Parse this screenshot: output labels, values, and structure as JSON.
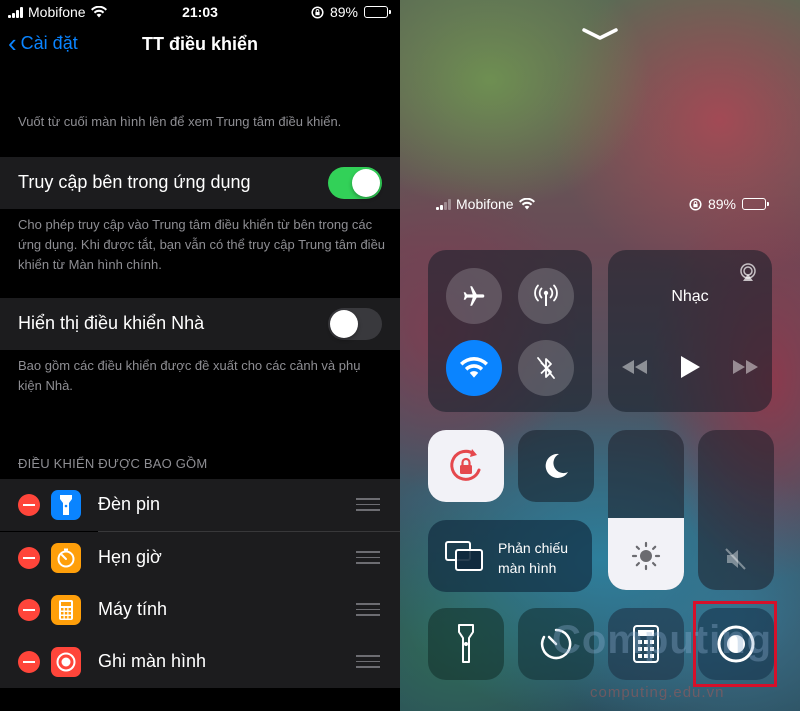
{
  "status_left": {
    "carrier": "Mobifone",
    "time": "21:03",
    "battery": "89%"
  },
  "settings": {
    "back_label": "Cài đặt",
    "title": "TT điều khiển",
    "intro": "Vuốt từ cuối màn hình lên để xem Trung tâm điều khiển.",
    "access_label": "Truy cập bên trong ứng dụng",
    "access_on": true,
    "access_desc": "Cho phép truy cập vào Trung tâm điều khiển từ bên trong các ứng dụng. Khi được tắt, bạn vẫn có thể truy cập Trung tâm điều khiển từ Màn hình chính.",
    "home_label": "Hiển thị điều khiển Nhà",
    "home_on": false,
    "home_desc": "Bao gồm các điều khiển được đề xuất cho các cảnh và phụ kiện Nhà.",
    "section_header": "ĐIỀU KHIỂN ĐƯỢC BAO GỒM",
    "controls": [
      {
        "label": "Đèn pin",
        "icon": "flashlight-icon",
        "color": "#0a84ff"
      },
      {
        "label": "Hẹn giờ",
        "icon": "timer-icon",
        "color": "#ff9f0a"
      },
      {
        "label": "Máy tính",
        "icon": "calculator-icon",
        "color": "#ff9f0a"
      },
      {
        "label": "Ghi màn hình",
        "icon": "screen-record-icon",
        "color": "#ff453a"
      }
    ]
  },
  "control_center": {
    "carrier": "Mobifone",
    "battery": "89%",
    "music_title": "Nhạc",
    "mirror_line1": "Phản chiếu",
    "mirror_line2": "màn hình",
    "brightness_level": 0.45
  },
  "colors": {
    "accent_blue": "#0a84ff",
    "toggle_green": "#32d158",
    "destructive_red": "#ff453a",
    "highlight_red": "#d6102a"
  },
  "watermark": {
    "brand": "Computing",
    "site": "computing.edu.vn"
  }
}
